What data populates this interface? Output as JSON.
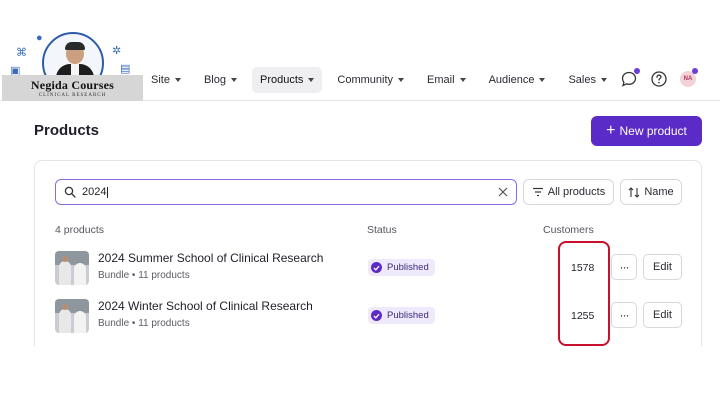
{
  "logo": {
    "title": "Negida Courses",
    "subtitle": "CLINICAL RESEARCH"
  },
  "nav": {
    "items": [
      {
        "label": "Site",
        "active": false
      },
      {
        "label": "Blog",
        "active": false
      },
      {
        "label": "Products",
        "active": true
      },
      {
        "label": "Community",
        "active": false
      },
      {
        "label": "Email",
        "active": false
      },
      {
        "label": "Audience",
        "active": false
      },
      {
        "label": "Sales",
        "active": false
      }
    ]
  },
  "user": {
    "initials": "NA"
  },
  "page": {
    "title": "Products",
    "new_button_label": "New product"
  },
  "search": {
    "value": "2024"
  },
  "filters": {
    "status_filter_label": "All products",
    "sort_label": "Name"
  },
  "table": {
    "count_label": "4 products",
    "status_header": "Status",
    "customers_header": "Customers",
    "rows": [
      {
        "name": "2024 Summer School of Clinical Research",
        "subtitle": "Bundle • 11 products",
        "status": "Published",
        "customers": "1578",
        "edit_label": "Edit",
        "more_label": "···"
      },
      {
        "name": "2024 Winter School of Clinical Research",
        "subtitle": "Bundle • 11 products",
        "status": "Published",
        "customers": "1255",
        "edit_label": "Edit",
        "more_label": "···"
      }
    ]
  },
  "colors": {
    "accent": "#5b2bc8",
    "highlight": "#c8102e"
  }
}
